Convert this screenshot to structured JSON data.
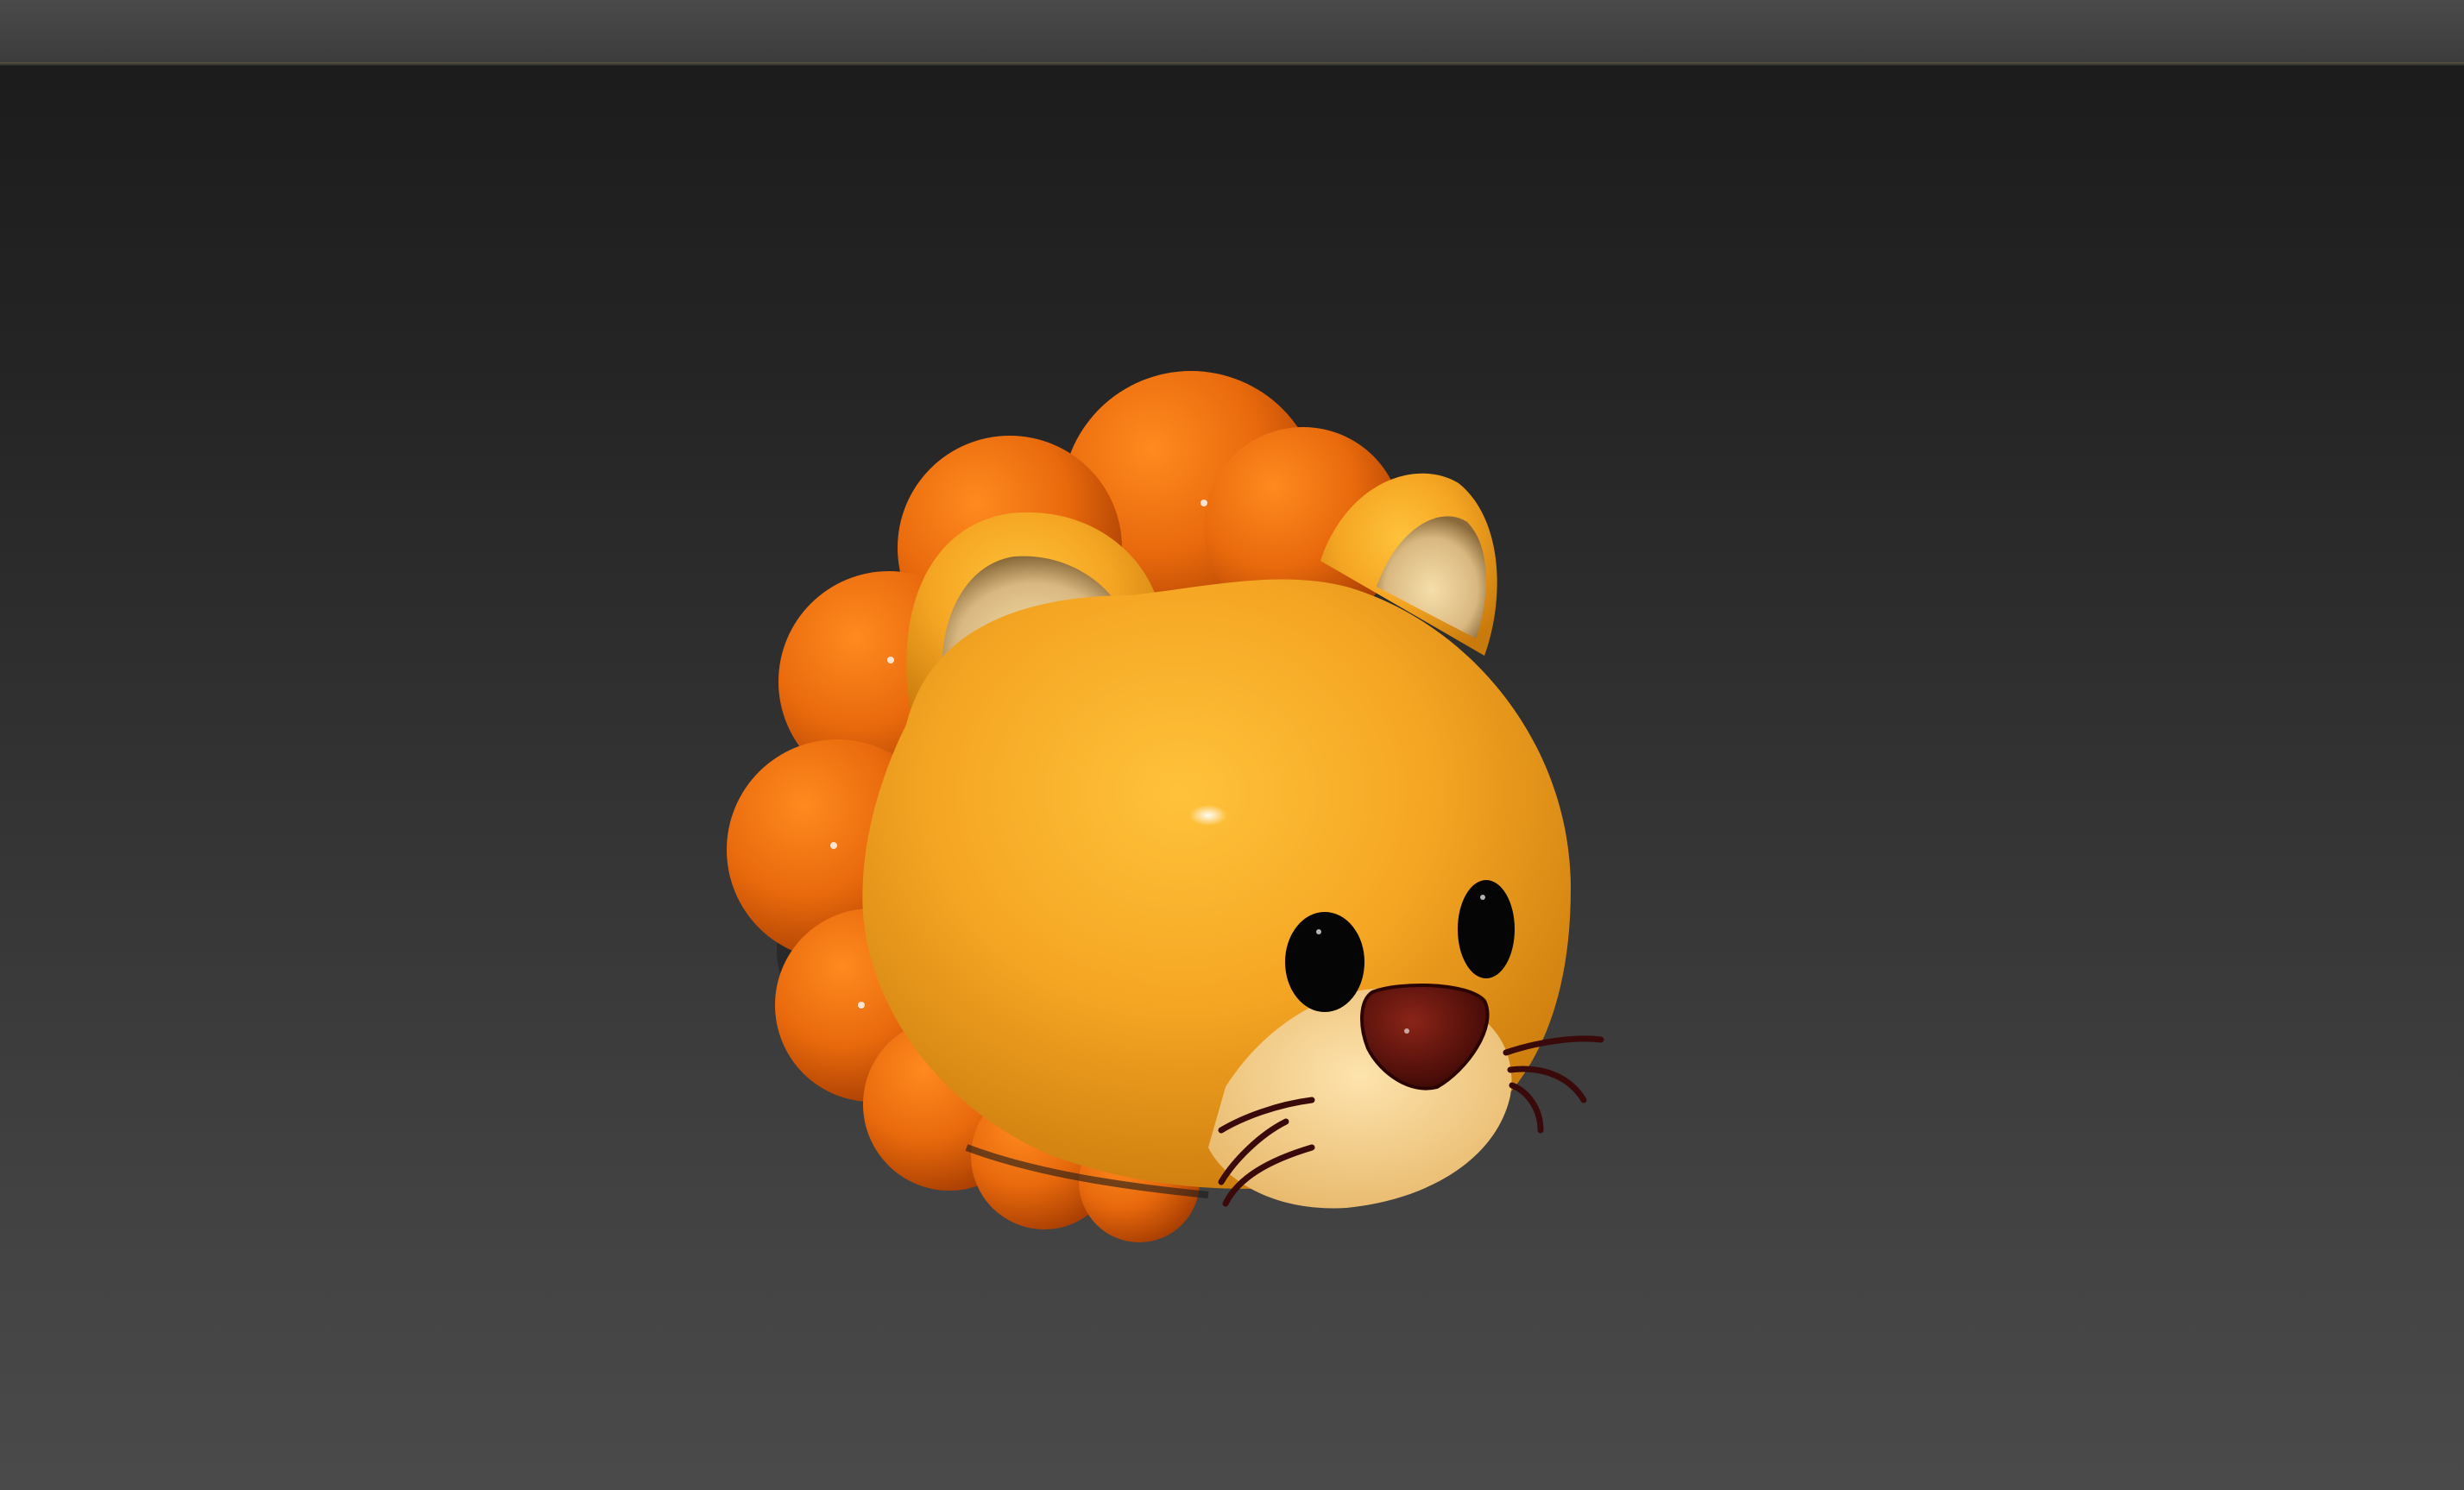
{
  "window": {
    "title": ""
  },
  "viewport": {
    "model_name": "lion head",
    "colors": {
      "background_top": "#1c1c1c",
      "background_bottom": "#4a4a4a",
      "mane": "#e8690c",
      "face": "#f5a623",
      "muzzle": "#f7d699",
      "nose": "#5a0f0a",
      "eyes": "#050505",
      "whiskers": "#3a0a0a"
    }
  }
}
